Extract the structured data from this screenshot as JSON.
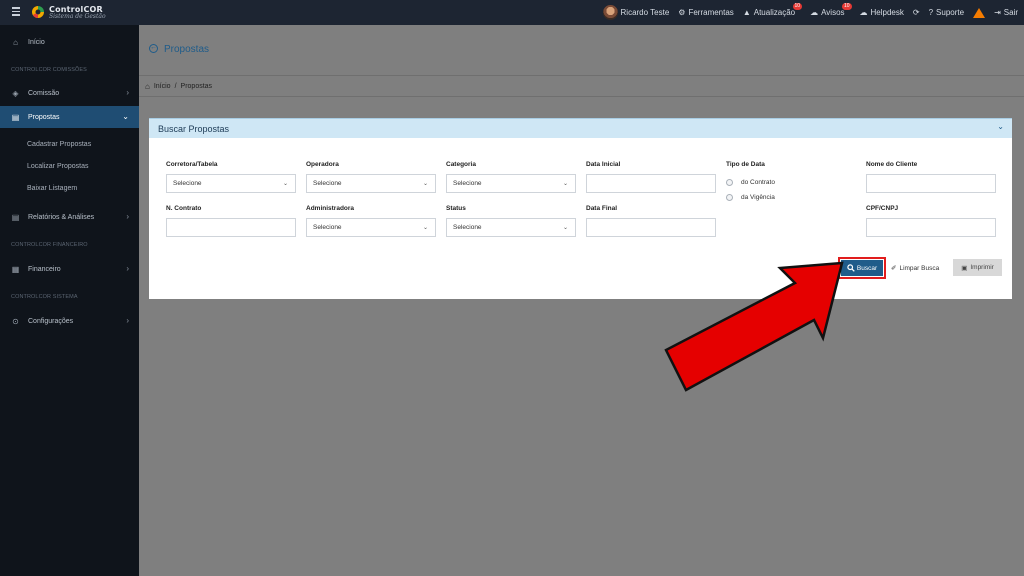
{
  "brand": {
    "title": "ControlCOR",
    "subtitle": "Sistema de Gestão"
  },
  "topbar": {
    "user": "Ricardo Teste",
    "ferramentas": "Ferramentas",
    "atualizacao": "Atualização",
    "atualizacao_badge": "10",
    "avisos": "Avisos",
    "avisos_badge": "10",
    "helpdesk": "Helpdesk",
    "suporte": "Suporte",
    "sair": "Sair"
  },
  "sidebar": {
    "inicio": "Início",
    "section_comissoes": "CONTROLCOR COMISSÕES",
    "comissao": "Comissão",
    "propostas": "Propostas",
    "sub_cadastrar": "Cadastrar Propostas",
    "sub_localizar": "Localizar Propostas",
    "sub_baixar": "Baixar Listagem",
    "relatorios": "Relatórios & Análises",
    "section_financeiro": "CONTROLCOR FINANCEIRO",
    "financeiro": "Financeiro",
    "section_sistema": "CONTROLCOR SISTEMA",
    "configuracoes": "Configurações"
  },
  "page": {
    "title": "Propostas",
    "breadcrumb_home": "Início",
    "breadcrumb_sep": "/",
    "breadcrumb_current": "Propostas"
  },
  "panel": {
    "title": "Buscar Propostas",
    "fields": {
      "corretora_label": "Corretora/Tabela",
      "corretora_value": "Selecione",
      "operadora_label": "Operadora",
      "operadora_value": "Selecione",
      "categoria_label": "Categoria",
      "categoria_value": "Selecione",
      "data_inicial_label": "Data Inicial",
      "data_inicial_value": "",
      "tipo_data_label": "Tipo de Data",
      "tipo_contrato": "do Contrato",
      "tipo_vigencia": "da Vigência",
      "nome_cliente_label": "Nome do Cliente",
      "nome_cliente_value": "",
      "contrato_label": "N. Contrato",
      "contrato_value": "",
      "administradora_label": "Administradora",
      "administradora_value": "Selecione",
      "status_label": "Status",
      "status_value": "Selecione",
      "data_final_label": "Data Final",
      "data_final_value": "",
      "cpf_label": "CPF/CNPJ",
      "cpf_value": ""
    },
    "buttons": {
      "buscar": "Buscar",
      "limpar": "Limpar Busca",
      "imprimir": "Imprimir"
    }
  },
  "colors": {
    "primary": "#1f5c8a",
    "sidebar_active": "#1f4d73",
    "arrow": "#e11d1d"
  }
}
